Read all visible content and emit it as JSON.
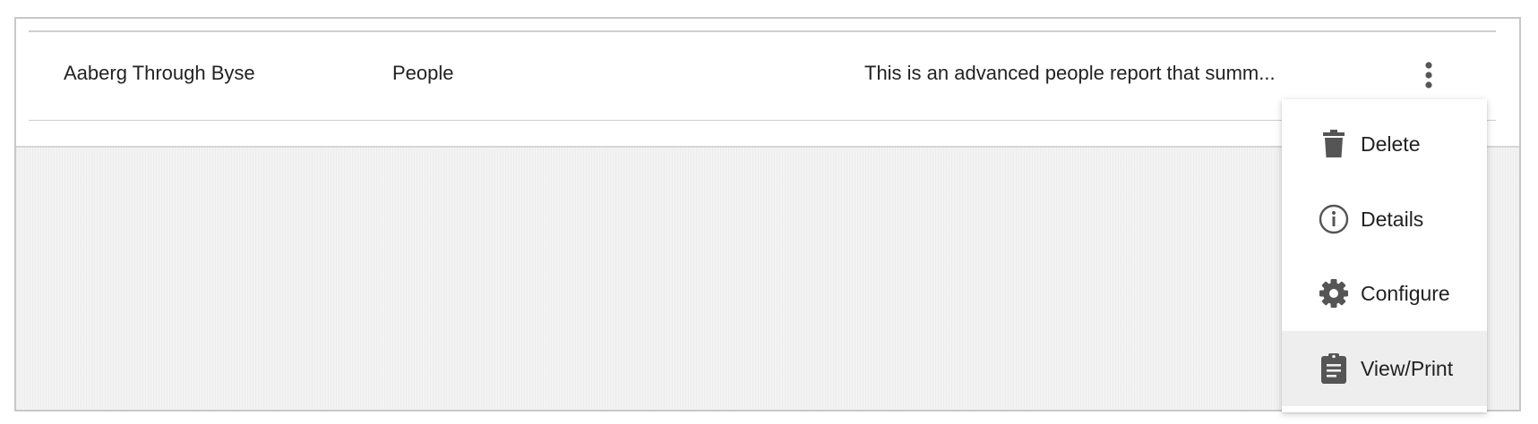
{
  "row": {
    "name": "Aaberg Through Byse",
    "type": "People",
    "description": "This is an advanced people report that summ..."
  },
  "row_actions": {
    "icon": "more-vertical-icon"
  },
  "menu": {
    "items": [
      {
        "label": "Delete",
        "icon": "trash-icon"
      },
      {
        "label": "Details",
        "icon": "info-icon"
      },
      {
        "label": "Configure",
        "icon": "gear-icon"
      },
      {
        "label": "View/Print",
        "icon": "clipboard-icon",
        "highlighted": true
      }
    ]
  },
  "colors": {
    "icon": "#555555",
    "highlight": "#eeeeee",
    "text": "#222222"
  }
}
